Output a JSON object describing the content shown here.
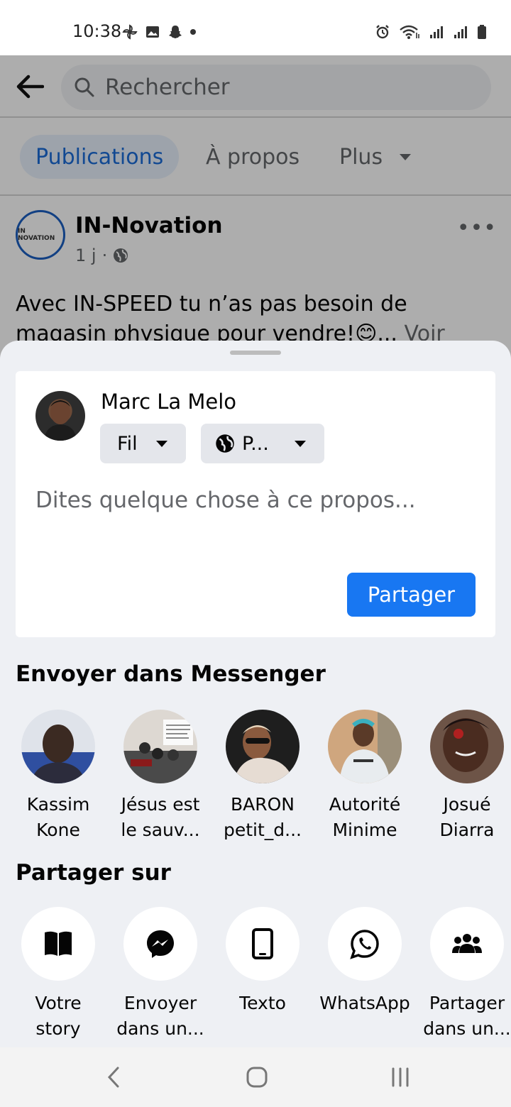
{
  "status_bar": {
    "time": "10:38",
    "left_icons": [
      "pinwheel-icon",
      "gallery-icon",
      "snapchat-icon",
      "dot-icon"
    ],
    "right_icons": [
      "alarm-icon",
      "wifi-icon",
      "signal-icon",
      "signal-icon",
      "battery-icon"
    ]
  },
  "search": {
    "placeholder": "Rechercher"
  },
  "tabs": [
    {
      "label": "Publications",
      "active": true
    },
    {
      "label": "À propos",
      "active": false
    },
    {
      "label": "Plus",
      "active": false
    }
  ],
  "post": {
    "page_name": "IN-Novation",
    "avatar_text": "IN NOVATION",
    "time": "1 j",
    "audience_icon": "globe-icon",
    "text_line1": "Avec IN-SPEED tu n’as pas besoin de",
    "text_line2": "magasin physique pour vendre!😊...",
    "see_more": "Voir"
  },
  "composer": {
    "user_name": "Marc La Melo",
    "destination": "Fil",
    "privacy": "P...",
    "placeholder": "Dites quelque chose à ce propos...",
    "share_label": "Partager"
  },
  "messenger": {
    "title": "Envoyer dans Messenger",
    "contacts": [
      {
        "line1": "Kassim",
        "line2": "Kone",
        "color": "#3a3f5a"
      },
      {
        "line1": "Jésus est",
        "line2": "le sauv...",
        "color": "#d9d4cf"
      },
      {
        "line1": "BARON",
        "line2": "petit_d...",
        "color": "#2a2a2a"
      },
      {
        "line1": "Autorité",
        "line2": "Minime",
        "color": "#c9a27a"
      },
      {
        "line1": "Josué",
        "line2": "Diarra",
        "color": "#5a3b2c"
      }
    ]
  },
  "share_on": {
    "title": "Partager sur",
    "items": [
      {
        "line1": "Votre",
        "line2": "story",
        "icon": "book-icon"
      },
      {
        "line1": "Envoyer",
        "line2": "dans un...",
        "icon": "messenger-icon"
      },
      {
        "line1": "Texto",
        "line2": "",
        "icon": "phone-icon"
      },
      {
        "line1": "WhatsApp",
        "line2": "",
        "icon": "whatsapp-icon"
      },
      {
        "line1": "Partager",
        "line2": "dans un...",
        "icon": "group-icon"
      }
    ]
  },
  "colors": {
    "accent": "#1877f2",
    "tab_active_bg": "#e7f0fd",
    "sheet_bg": "#eef0f4"
  }
}
